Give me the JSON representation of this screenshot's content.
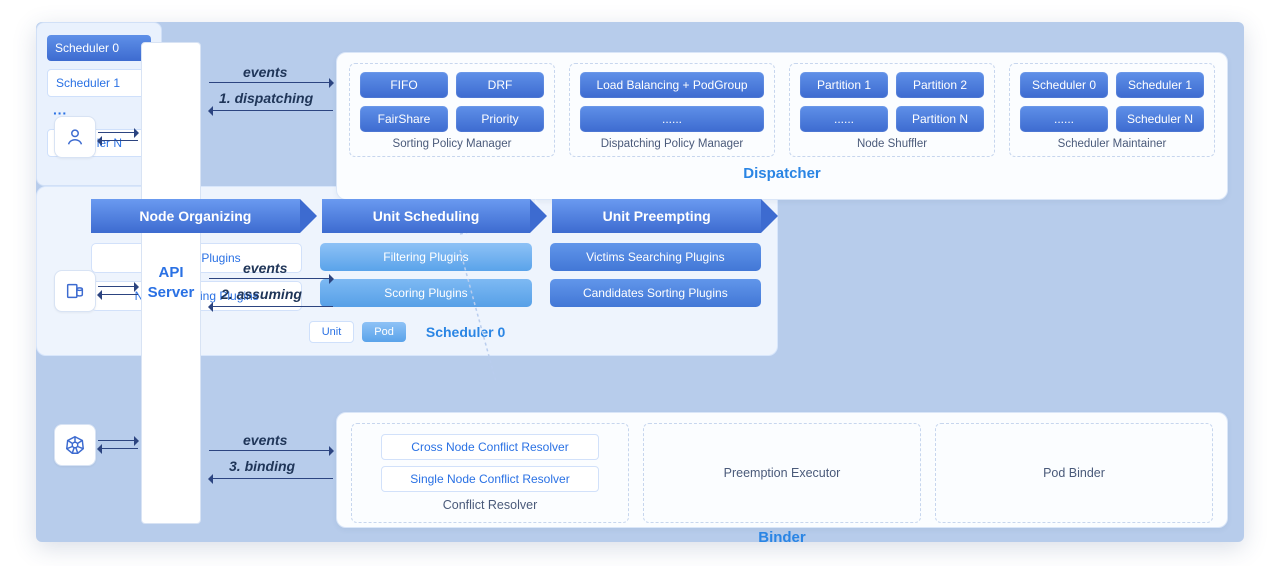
{
  "api_server_label": "API\nServer",
  "arrows": {
    "events": "events",
    "dispatching": "1. dispatching",
    "assuming": "2. assuming",
    "binding": "3. binding"
  },
  "dispatcher": {
    "title": "Dispatcher",
    "sorting": {
      "title": "Sorting Policy Manager",
      "items": [
        "FIFO",
        "DRF",
        "FairShare",
        "Priority"
      ]
    },
    "dispatching": {
      "title": "Dispatching Policy Manager",
      "main": "Load Balancing + PodGroup",
      "more": "......"
    },
    "shuffler": {
      "title": "Node Shuffler",
      "items": [
        "Partition 1",
        "Partition 2",
        "......",
        "Partition N"
      ]
    },
    "maintainer": {
      "title": "Scheduler Maintainer",
      "items": [
        "Scheduler 0",
        "Scheduler 1",
        "......",
        "Scheduler N"
      ]
    }
  },
  "scheduler_list": [
    "Scheduler 0",
    "Scheduler 1",
    "Scheduler N"
  ],
  "scheduler0": {
    "title": "Scheduler 0",
    "steps": [
      "Node Organizing",
      "Unit Scheduling",
      "Unit Preempting"
    ],
    "col1": [
      "Locating Plugins",
      "Node Grouping Plugins"
    ],
    "col2": [
      "Filtering Plugins",
      "Scoring Plugins"
    ],
    "col3": [
      "Victims Searching Plugins",
      "Candidates Sorting Plugins"
    ],
    "tags": {
      "unit": "Unit",
      "pod": "Pod"
    }
  },
  "binder": {
    "title": "Binder",
    "conflict": {
      "title": "Conflict Resolver",
      "items": [
        "Cross Node Conflict Resolver",
        "Single Node Conflict Resolver"
      ]
    },
    "preemption": "Preemption Executor",
    "podbinder": "Pod Binder"
  },
  "icons": {
    "user": "user-icon",
    "db": "database-icon",
    "k8s": "kubernetes-icon"
  }
}
